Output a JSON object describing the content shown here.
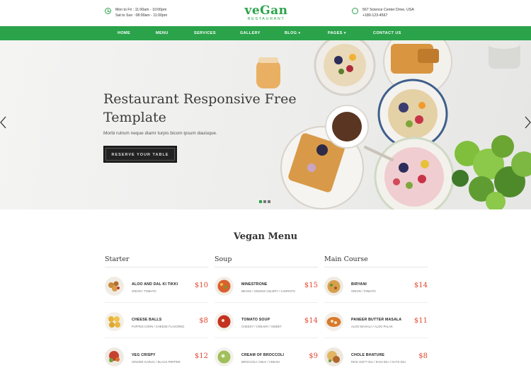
{
  "header": {
    "hours": [
      "Mon to Fri : 11:00am - 10:00pm",
      "Sat to Sun : 08:00am - 11:00pm"
    ],
    "brand": {
      "name": "veGan",
      "subtitle": "RESTAURANT"
    },
    "contact": [
      "567 Science Center Drive, USA",
      "+180-123-4567"
    ]
  },
  "nav": {
    "items": [
      {
        "label": "HOME"
      },
      {
        "label": "MENU"
      },
      {
        "label": "SERVICES"
      },
      {
        "label": "GALLERY"
      },
      {
        "label": "BLOG",
        "caret": "▾"
      },
      {
        "label": "PAGES",
        "caret": "▾"
      },
      {
        "label": "CONTACT US"
      }
    ]
  },
  "hero": {
    "title": "Restaurant Responsive Free Template",
    "tagline": "Morbi rutrum neque diamr turpis bicom ipsum dauisque.",
    "cta_label": "RESERVE YOUR TABLE",
    "slide_count": 3,
    "active_slide": 1
  },
  "menu": {
    "title": "Vegan Menu",
    "columns": [
      {
        "heading": "Starter",
        "items": [
          {
            "name": "ALOO AND DAL KI TIKKI",
            "desc": "ONION / TOMATO",
            "price": "$10"
          },
          {
            "name": "CHEESE BALLS",
            "desc": "PUFFED CORN / CHEESE FLAVORED",
            "price": "$8"
          },
          {
            "name": "VEG CRISPY",
            "desc": "GINGER GARLIC / BLACK PEPPER",
            "price": "$12"
          }
        ]
      },
      {
        "heading": "Soup",
        "items": [
          {
            "name": "MINESTRONE",
            "desc": "BEANS / ONIONS CELERY / CARROTS",
            "price": "$15"
          },
          {
            "name": "TOMATO SOUP",
            "desc": "CHEESY / CREAMY / SWEET",
            "price": "$14"
          },
          {
            "name": "CREAM OF BROCCOLI",
            "desc": "BROCCOLI / MILK / CREAM",
            "price": "$9"
          }
        ]
      },
      {
        "heading": "Main Course",
        "items": [
          {
            "name": "BIRYANI",
            "desc": "ONION / TOMATO",
            "price": "$14"
          },
          {
            "name": "PANEER BUTTER MASALA",
            "desc": "ALOO MASALA / ALOO PALAK",
            "price": "$11"
          },
          {
            "name": "CHOLE BHATURE",
            "desc": "RICE SOFT IDLI / RAGI IDLI / OATS IDLI",
            "price": "$8"
          }
        ]
      }
    ]
  },
  "colors": {
    "brand_green": "#2aa34a",
    "price_red": "#e14a32",
    "button_dark": "#222222"
  },
  "icons": [
    "clock-icon",
    "location-icon",
    "chevron-left-icon",
    "chevron-right-icon"
  ]
}
